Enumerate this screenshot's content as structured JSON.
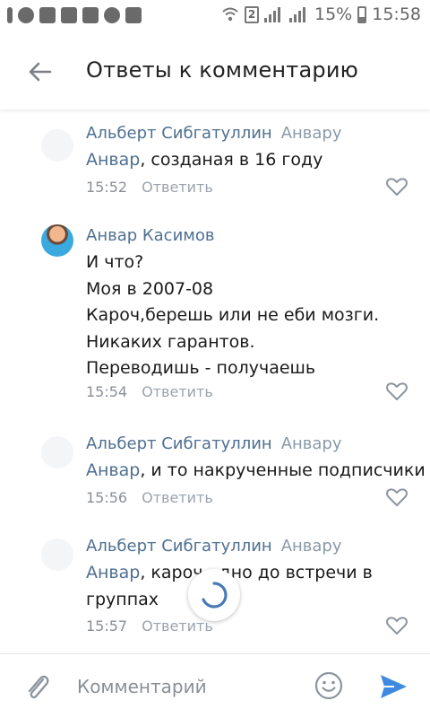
{
  "status_bar": {
    "sim_slot": "2",
    "battery": "15%",
    "time": "15:58"
  },
  "header": {
    "title": "Ответы к комментарию"
  },
  "comments": [
    {
      "author": "Альберт Сибгатуллин",
      "reply_to": "Анвару",
      "mention": "Анвар",
      "lines": [
        ", созданая в 16 году"
      ],
      "time": "15:52",
      "reply_label": "Ответить"
    },
    {
      "author": "Анвар Касимов",
      "reply_to": "",
      "mention": "",
      "lines": [
        "И что?",
        "Моя в 2007-08",
        "Кароч,берешь или не еби мозги.",
        "Никаких гарантов.",
        "Переводишь - получаешь"
      ],
      "time": "15:54",
      "reply_label": "Ответить"
    },
    {
      "author": "Альберт Сибгатуллин",
      "reply_to": "Анвару",
      "mention": "Анвар",
      "lines": [
        ", и то накрученные подписчики"
      ],
      "time": "15:56",
      "reply_label": "Ответить"
    },
    {
      "author": "Альберт Сибгатуллин",
      "reply_to": "Анвару",
      "mention": "Анвар",
      "lines": [
        ", кароч...дно до встречи в",
        "группах"
      ],
      "time": "15:57",
      "reply_label": "Ответить"
    }
  ],
  "composer": {
    "placeholder": "Комментарий"
  },
  "colors": {
    "link": "#4e6f92",
    "send": "#3f8ae0"
  }
}
